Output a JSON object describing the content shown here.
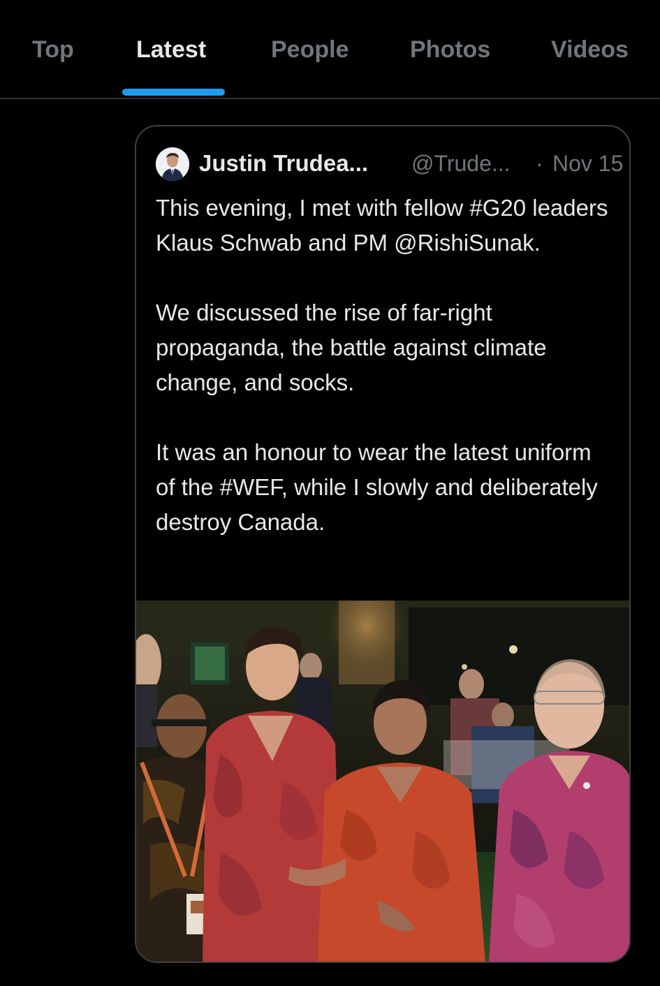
{
  "tabs": {
    "items": [
      {
        "label": "Top"
      },
      {
        "label": "Latest"
      },
      {
        "label": "People"
      },
      {
        "label": "Photos"
      },
      {
        "label": "Videos"
      }
    ],
    "active": "Latest",
    "indicator_color": "#1d9bf0"
  },
  "tweet": {
    "author_name": "Justin Trudea...",
    "author_handle": "@Trude...",
    "separator": "·",
    "date": "Nov 15",
    "paragraphs": [
      "This evening, I met with fellow #G20 leaders Klaus Schwab and PM @RishiSunak.",
      "We discussed the rise of far-right propaganda, the battle against climate change, and socks.",
      "It was an honour to wear the latest uniform of the #WEF, while I slowly and deliberately destroy Canada."
    ],
    "avatar_icon": "profile-avatar",
    "media": "photo of four men in red batik shirts at an evening event"
  },
  "colors": {
    "background": "#000000",
    "text_primary": "#e7e9ea",
    "text_secondary": "#71767b",
    "border": "#3e4144",
    "accent": "#1d9bf0"
  }
}
